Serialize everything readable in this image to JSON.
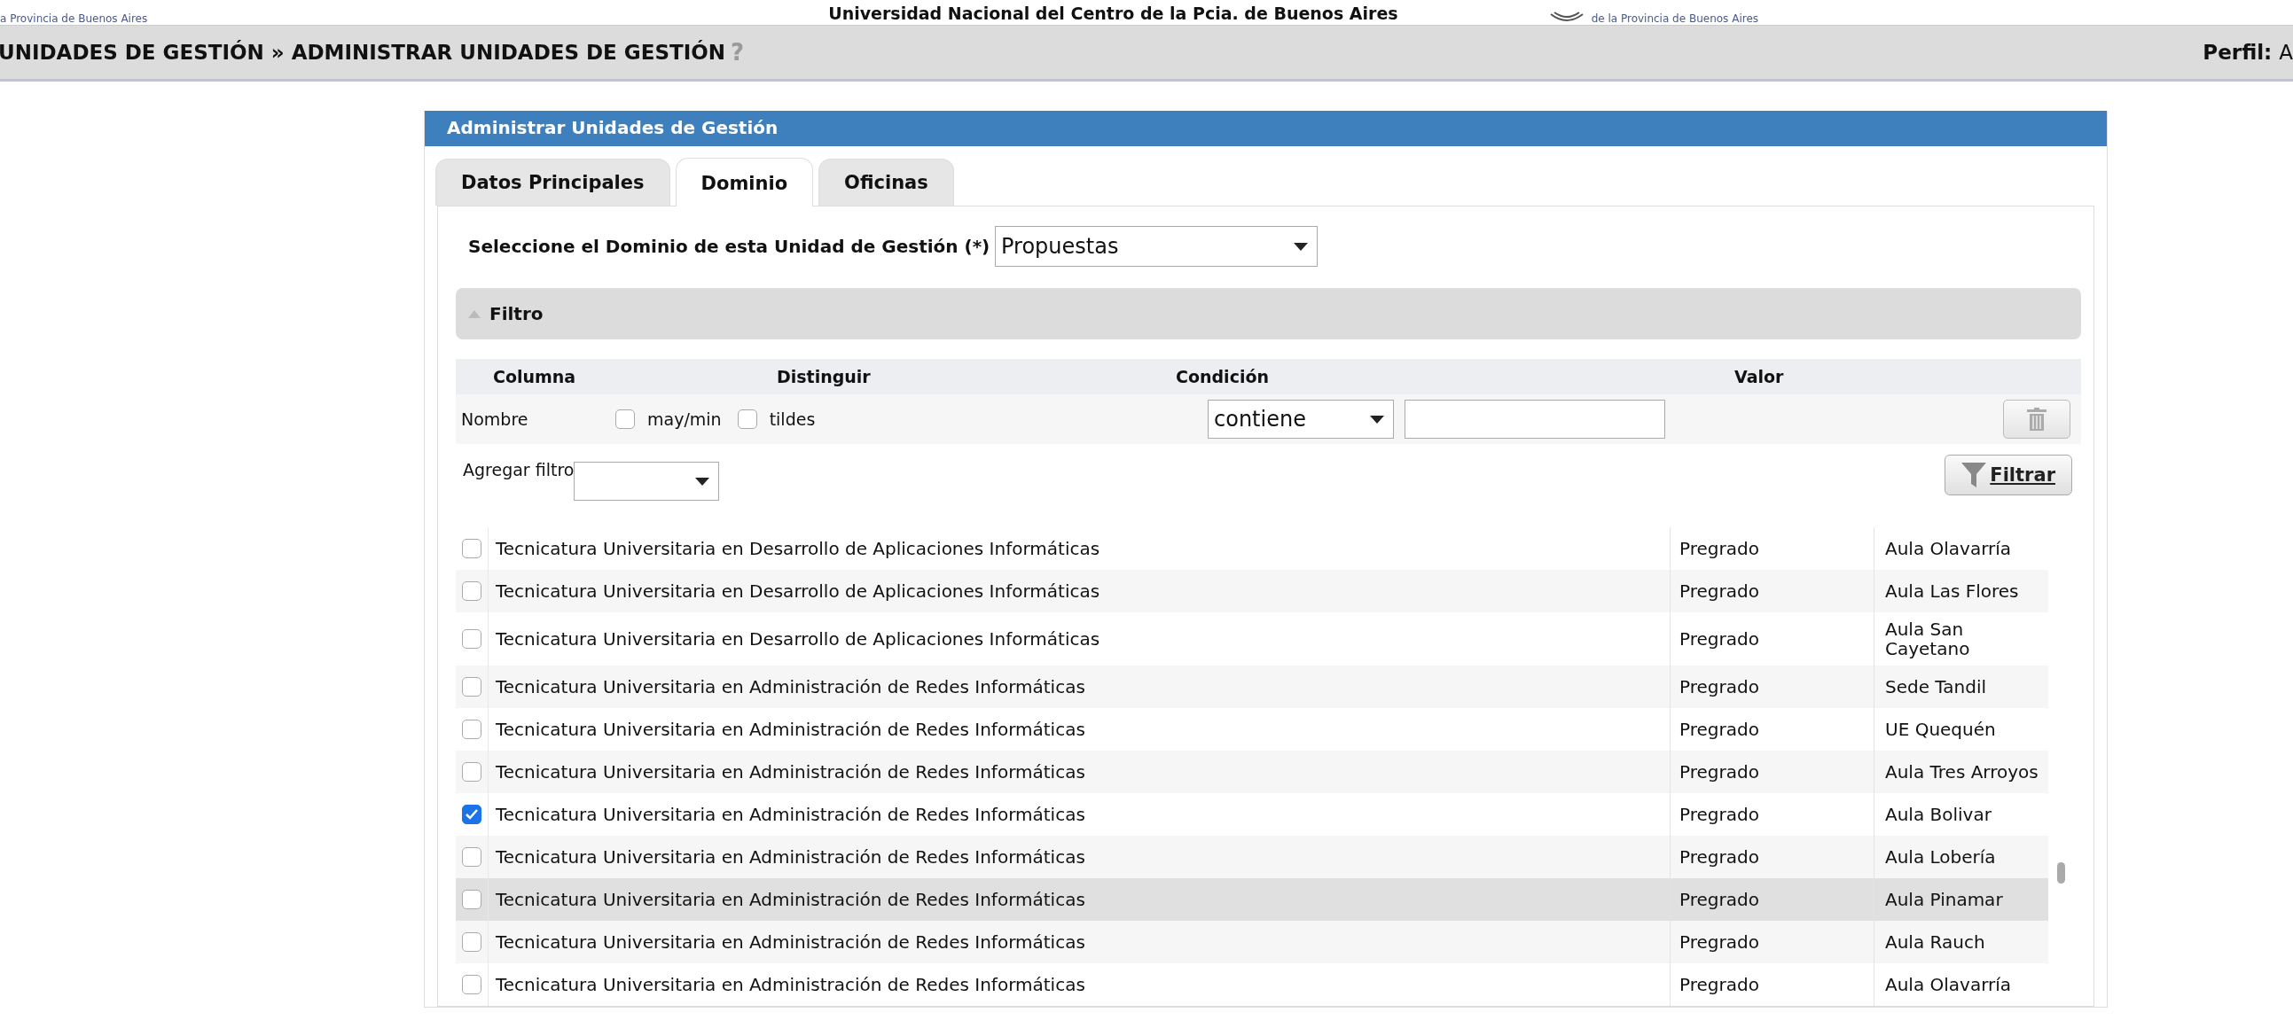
{
  "header": {
    "left_caption": "a Provincia de Buenos Aires",
    "title": "Universidad Nacional del Centro de la Pcia. de Buenos Aires",
    "right_caption": "de la Provincia de Buenos Aires"
  },
  "breadcrumb": {
    "text": "UNIDADES DE GESTIÓN » ADMINISTRAR UNIDADES DE GESTIÓN",
    "help": "?",
    "profile_label": "Perfil:",
    "profile_value": "A"
  },
  "panel": {
    "title": "Administrar Unidades de Gestión"
  },
  "tabs": [
    {
      "label": "Datos Principales",
      "selected": false
    },
    {
      "label": "Dominio",
      "selected": true
    },
    {
      "label": "Oficinas",
      "selected": false
    }
  ],
  "domain": {
    "label": "Seleccione el Dominio de esta Unidad de Gestión (*)",
    "value": "Propuestas"
  },
  "filter": {
    "title": "Filtro",
    "expanded": true,
    "columns": [
      "Columna",
      "Distinguir",
      "Condición",
      "Valor"
    ],
    "row": {
      "column": "Nombre",
      "options": [
        {
          "label": "may/min",
          "checked": false
        },
        {
          "label": "tildes",
          "checked": false
        }
      ],
      "condition": "contiene"
    },
    "add_label": "Agregar filtro",
    "apply_button": "Filtrar"
  },
  "rows": [
    {
      "name": "Tecnicatura Universitaria en Desarrollo de Aplicaciones Informáticas",
      "level": "Pregrado",
      "location": "Aula Olavarría",
      "checked": false,
      "hovered": false
    },
    {
      "name": "Tecnicatura Universitaria en Desarrollo de Aplicaciones Informáticas",
      "level": "Pregrado",
      "location": "Aula Las Flores",
      "checked": false,
      "hovered": false
    },
    {
      "name": "Tecnicatura Universitaria en Desarrollo de Aplicaciones Informáticas",
      "level": "Pregrado",
      "location": "Aula San Cayetano",
      "checked": false,
      "hovered": false
    },
    {
      "name": "Tecnicatura Universitaria en Administración de Redes Informáticas",
      "level": "Pregrado",
      "location": "Sede Tandil",
      "checked": false,
      "hovered": false
    },
    {
      "name": "Tecnicatura Universitaria en Administración de Redes Informáticas",
      "level": "Pregrado",
      "location": "UE Quequén",
      "checked": false,
      "hovered": false
    },
    {
      "name": "Tecnicatura Universitaria en Administración de Redes Informáticas",
      "level": "Pregrado",
      "location": "Aula Tres Arroyos",
      "checked": false,
      "hovered": false
    },
    {
      "name": "Tecnicatura Universitaria en Administración de Redes Informáticas",
      "level": "Pregrado",
      "location": "Aula Bolivar",
      "checked": true,
      "hovered": false
    },
    {
      "name": "Tecnicatura Universitaria en Administración de Redes Informáticas",
      "level": "Pregrado",
      "location": "Aula Lobería",
      "checked": false,
      "hovered": false
    },
    {
      "name": "Tecnicatura Universitaria en Administración de Redes Informáticas",
      "level": "Pregrado",
      "location": "Aula Pinamar",
      "checked": false,
      "hovered": true
    },
    {
      "name": "Tecnicatura Universitaria en Administración de Redes Informáticas",
      "level": "Pregrado",
      "location": "Aula Rauch",
      "checked": false,
      "hovered": false
    },
    {
      "name": "Tecnicatura Universitaria en Administración de Redes Informáticas",
      "level": "Pregrado",
      "location": "Aula Olavarría",
      "checked": false,
      "hovered": false
    }
  ]
}
